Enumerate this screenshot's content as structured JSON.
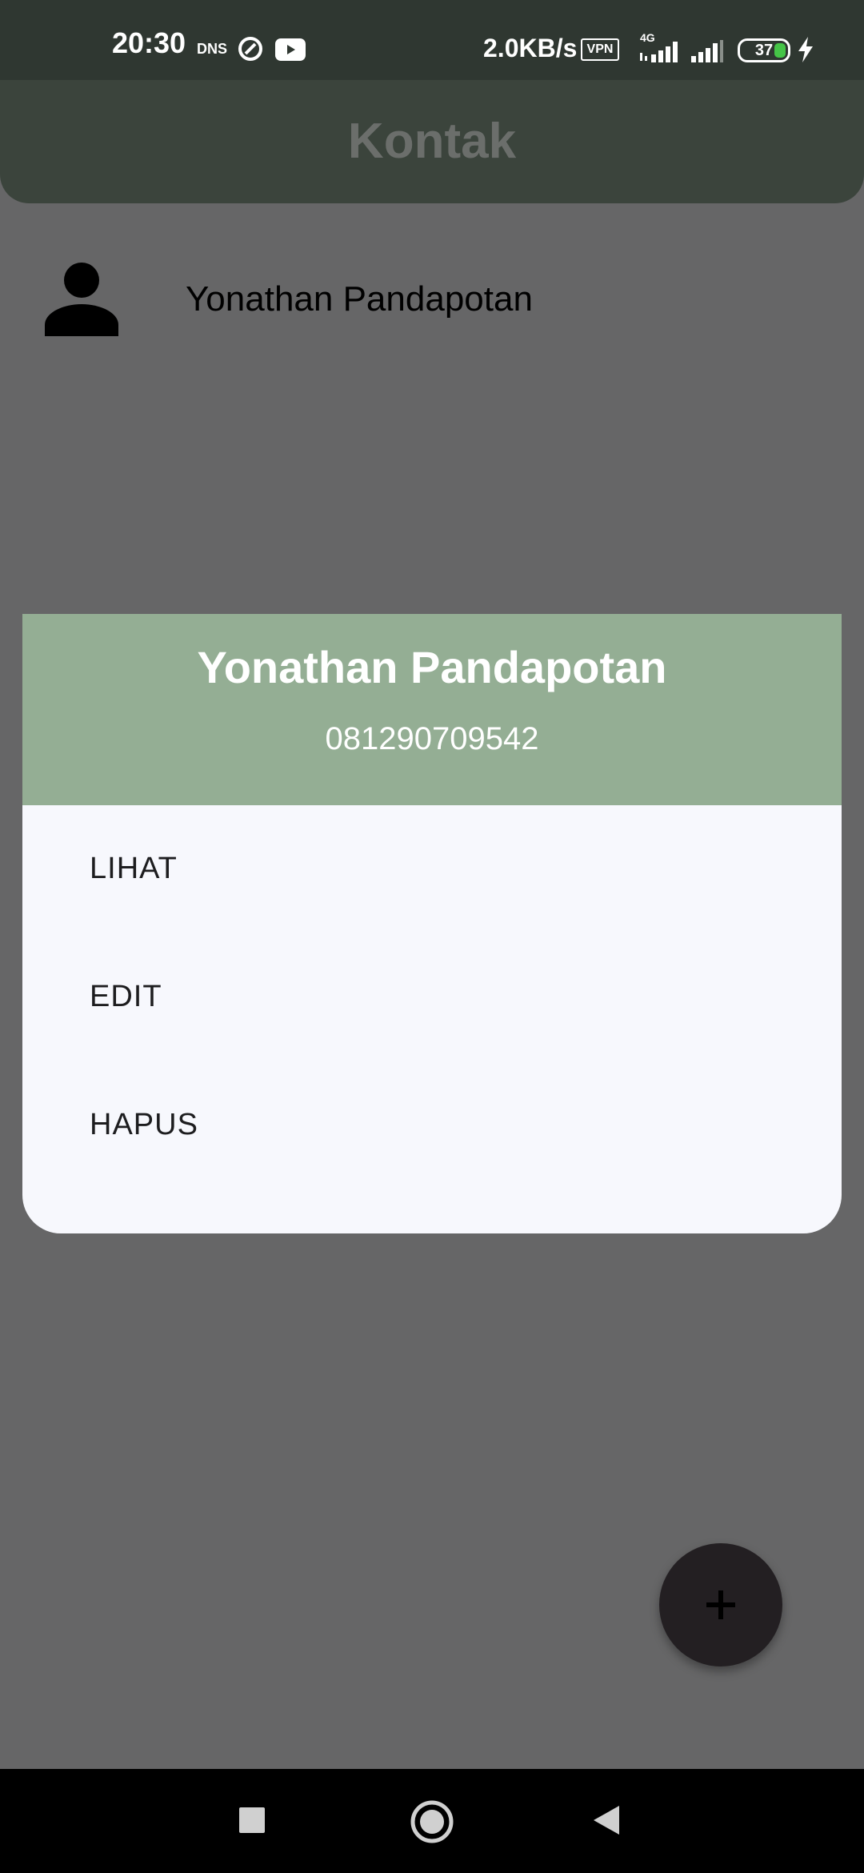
{
  "status_bar": {
    "time": "20:30",
    "dns_label": "DNS",
    "speed": "2.0KB/s",
    "vpn_label": "VPN",
    "network_type": "4G",
    "battery_level": "37",
    "icons": [
      "sync-icon",
      "youtube-icon",
      "signal-icon",
      "signal-icon",
      "battery-icon",
      "charging-icon"
    ]
  },
  "app_bar": {
    "title": "Kontak"
  },
  "contacts": [
    {
      "name": "Yonathan Pandapotan",
      "icon": "person-icon"
    }
  ],
  "dialog": {
    "name": "Yonathan Pandapotan",
    "phone": "081290709542",
    "options": [
      "LIHAT",
      "EDIT",
      "HAPUS"
    ]
  },
  "fab": {
    "icon": "plus-icon"
  },
  "nav_bar": {
    "icons": [
      "recents-icon",
      "home-icon",
      "back-icon"
    ]
  },
  "colors": {
    "scrim": "#666667",
    "status_bar": "#2f3731",
    "app_bar": "#3b443c",
    "dialog_header": "#94ae94",
    "dialog_body": "#f7f8fd",
    "fab": "#231f22",
    "battery_fill": "#45c447"
  }
}
